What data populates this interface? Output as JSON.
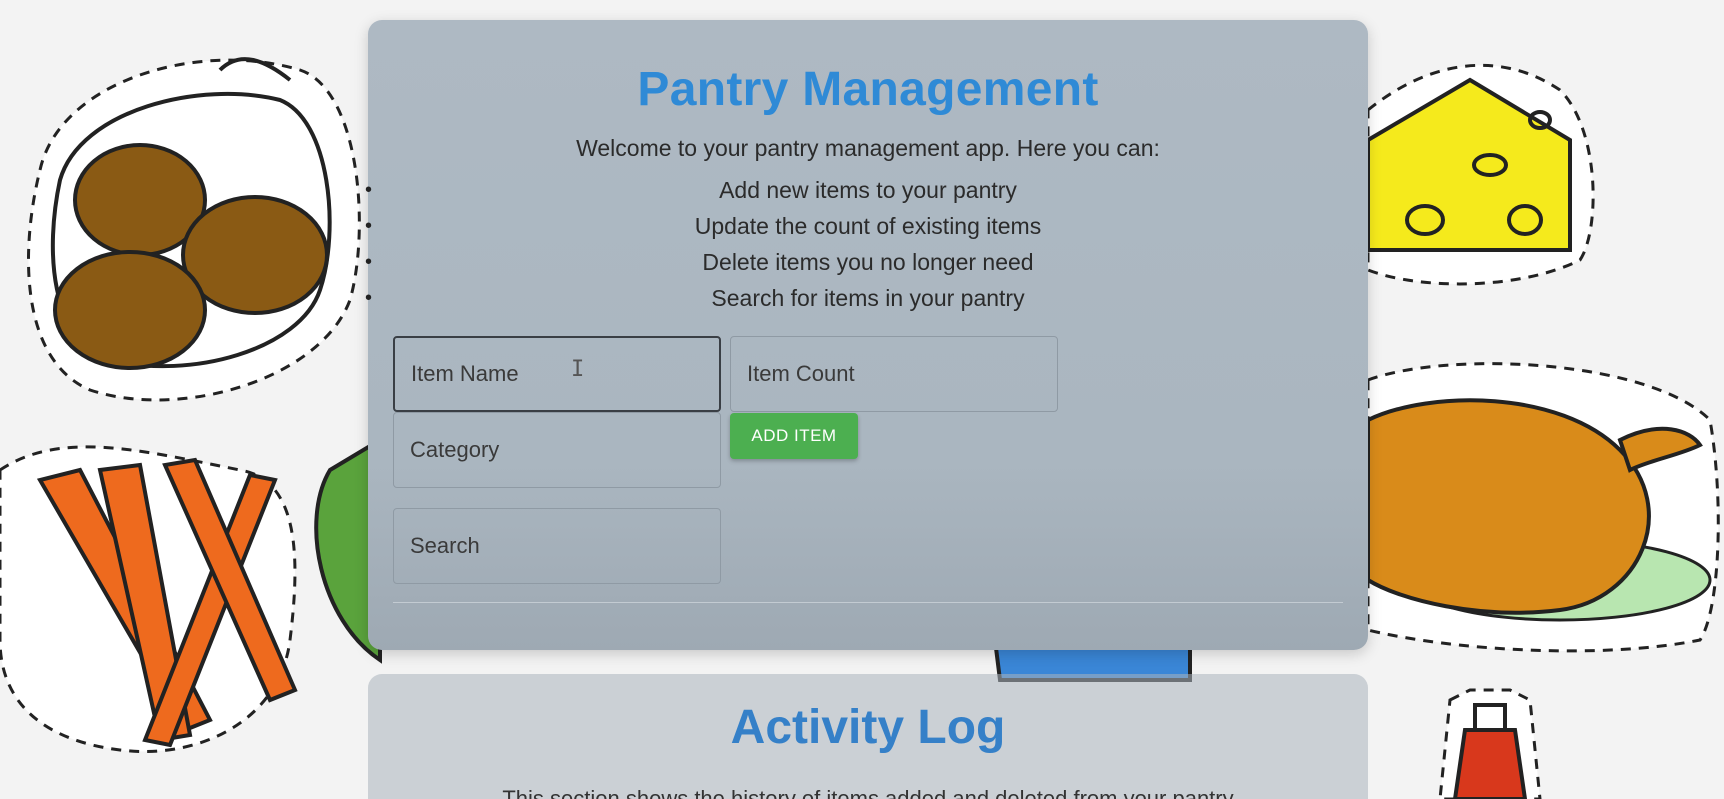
{
  "pantry": {
    "title": "Pantry Management",
    "intro": "Welcome to your pantry management app. Here you can:",
    "features": [
      "Add new items to your pantry",
      "Update the count of existing items",
      "Delete items you no longer need",
      "Search for items in your pantry"
    ],
    "form": {
      "item_name_placeholder": "Item Name",
      "item_count_placeholder": "Item Count",
      "category_placeholder": "Category",
      "search_placeholder": "Search",
      "add_button_label": "ADD ITEM"
    }
  },
  "activity_log": {
    "title": "Activity Log",
    "description": "This section shows the history of items added and deleted from your pantry"
  },
  "icons": {
    "bullet": "•",
    "text_cursor": "I"
  },
  "colors": {
    "title_blue": "#2f8ad6",
    "add_button_green": "#4caf50"
  }
}
